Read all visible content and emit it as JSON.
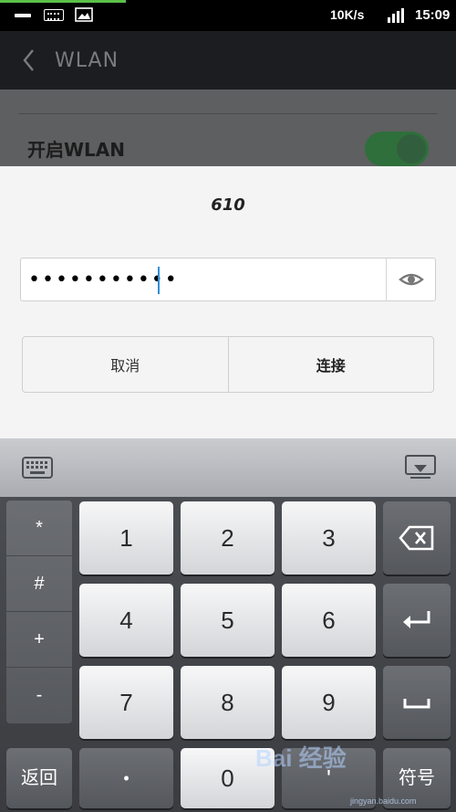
{
  "status_bar": {
    "speed": "10K/s",
    "time": "15:09"
  },
  "app_bar": {
    "title": "WLAN"
  },
  "settings": {
    "wlan_toggle_label": "开启WLAN",
    "wlan_enabled": true
  },
  "dialog": {
    "network_name": "610",
    "password_value": "•••••••••••",
    "cancel_label": "取消",
    "connect_label": "连接"
  },
  "keyboard": {
    "symbols": [
      "*",
      "#",
      "+",
      "-"
    ],
    "keys": {
      "k1": "1",
      "k2": "2",
      "k3": "3",
      "k4": "4",
      "k5": "5",
      "k6": "6",
      "k7": "7",
      "k8": "8",
      "k9": "9",
      "dot": "•",
      "k0": "0",
      "comma": "'"
    },
    "back_label": "返回",
    "symbol_label": "符号"
  },
  "watermark": {
    "text": "Bai 经验",
    "sub": "jingyan.baidu.com"
  }
}
